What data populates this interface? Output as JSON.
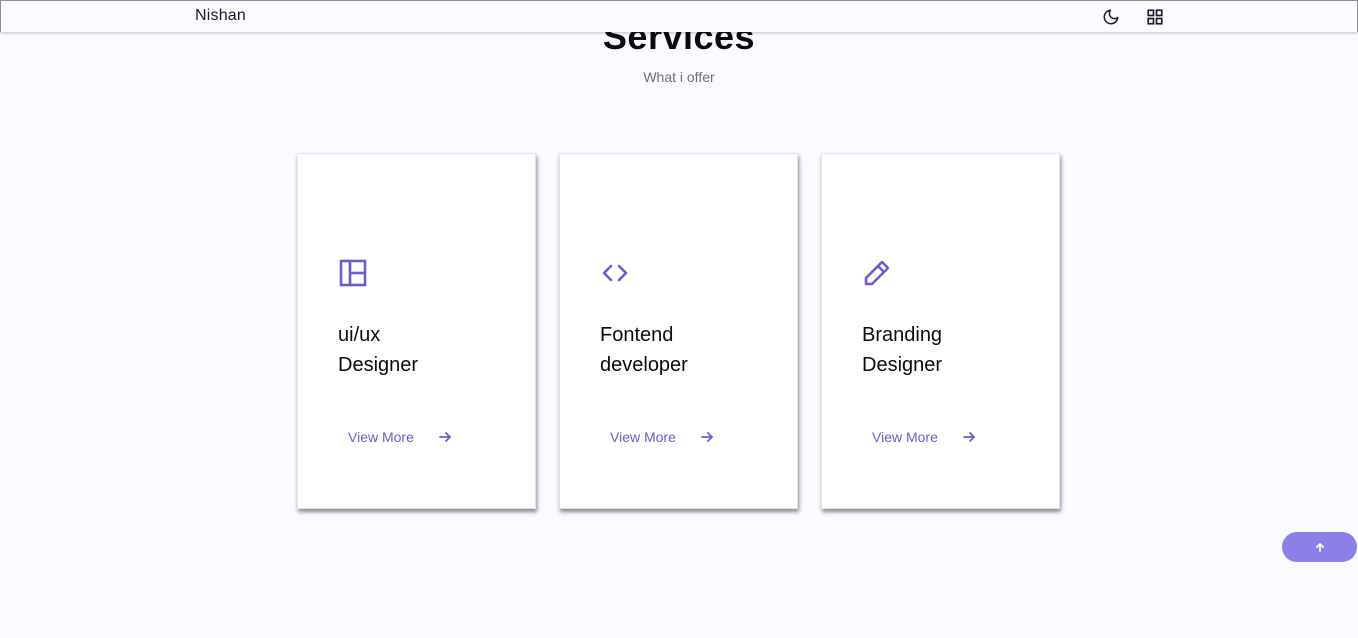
{
  "header": {
    "logo": "Nishan",
    "theme_icon": "moon-icon",
    "menu_icon": "grid-icon"
  },
  "section": {
    "title": "Services",
    "subtitle": "What i offer"
  },
  "accent_color": "#6c5ccf",
  "cards": [
    {
      "icon": "layout-icon",
      "title_line1": "ui/ux",
      "title_line2": "Designer",
      "link": "View More"
    },
    {
      "icon": "code-icon",
      "title_line1": "Fontend",
      "title_line2": "developer",
      "link": "View More"
    },
    {
      "icon": "pencil-icon",
      "title_line1": "Branding",
      "title_line2": "Designer",
      "link": "View More"
    }
  ],
  "scroll_up_icon": "arrow-up-icon"
}
